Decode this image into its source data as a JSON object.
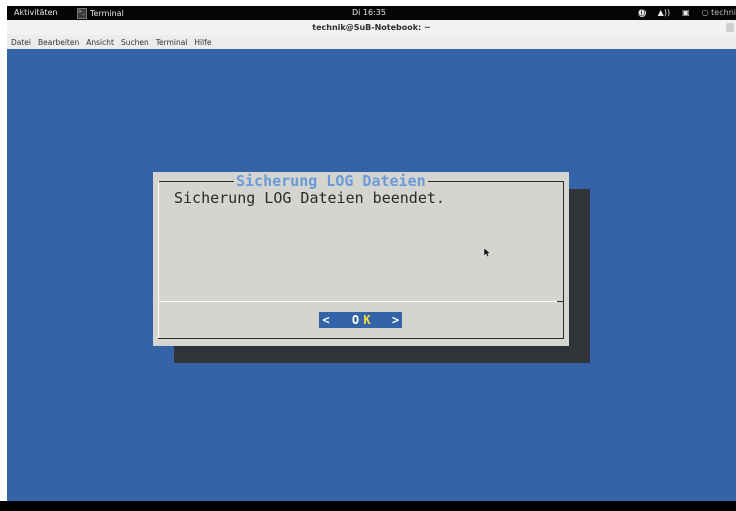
{
  "topbar": {
    "activities": "Aktivitäten",
    "app_name": "Terminal",
    "clock": "Di 16:35",
    "user": "techni"
  },
  "window": {
    "title": "technik@SuB-Notebook: ~"
  },
  "menu": [
    "Datei",
    "Bearbeiten",
    "Ansicht",
    "Suchen",
    "Terminal",
    "Hilfe"
  ],
  "dialog": {
    "title": "Sicherung LOG Dateien",
    "message": "Sicherung LOG Dateien beendet.",
    "button": {
      "left": "<",
      "o": "O",
      "k": "K",
      "right": ">"
    }
  },
  "colors": {
    "terminal_bg": "#3464a7",
    "dialog_bg": "#d4d5d0",
    "dialog_title": "#6b9ad8",
    "button_hotkey": "#f3e03a"
  }
}
